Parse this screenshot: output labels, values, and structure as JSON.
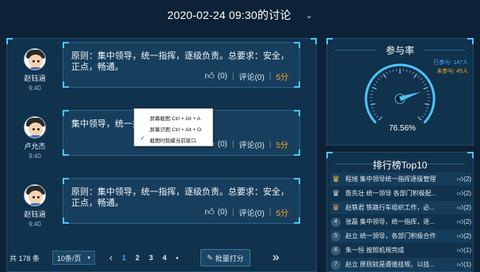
{
  "header": {
    "title": "2020-02-24 09:30的讨论",
    "chevron_icon": "chevron-down-icon"
  },
  "posts": [
    {
      "author": "赵钰涵",
      "time": "9:40",
      "content": "原则：集中领导，统一指挥，逐级负责。总要求：安全，正点，畅通。",
      "likes": "(0)",
      "comments": "评论(0)",
      "score": "5分"
    },
    {
      "author": "卢允杰",
      "time": "9:40",
      "content": "集中领导，统一指挥",
      "likes": "(0)",
      "comments": "评论(0)",
      "score": "5分"
    },
    {
      "author": "赵钰涵",
      "time": "9:40",
      "content": "原则：集中领导，统一指挥，逐级负责。总要求：安全，正点，畅通。",
      "likes": "(0)",
      "comments": "评论(0)",
      "score": "5分"
    }
  ],
  "pagination": {
    "total": "共 178 条",
    "page_size": "10条/页",
    "pages": [
      "1",
      "2",
      "3",
      "4"
    ],
    "ellipsis": "•",
    "active_page": "1",
    "batch_button": "批量打分"
  },
  "context_menu": {
    "items": [
      "屏幕截图 Ctrl + Alt + A",
      "屏幕识图 Ctrl + Alt + O",
      "截图时隐藏当前窗口"
    ],
    "checked_item": "截图时隐藏当前窗口"
  },
  "participation": {
    "title": "参与率",
    "joined_label": "已参与: 147人",
    "not_joined_label": "未参与: 45人",
    "percent_text": "76.56%",
    "value": 76.56,
    "colors": {
      "joined": "#4fa8ff",
      "not_joined": "#f5a623",
      "accent": "#4fc3f7"
    }
  },
  "ranking": {
    "title": "排行榜Top10",
    "rows": [
      {
        "rank": "1",
        "text": "程旭 集中领导统一指挥逐级管理",
        "likes": "(2)"
      },
      {
        "rank": "2",
        "text": "詹先壮 统一领导 各部门积极配...",
        "likes": "(2)"
      },
      {
        "rank": "3",
        "text": "赵轶君 铁路行车组织工作，必...",
        "likes": "(2)"
      },
      {
        "rank": "4",
        "text": "张磊 集中领导，统一指挥，逐...",
        "likes": "(2)"
      },
      {
        "rank": "5",
        "text": "赵立 统一领导，各部门积极合作",
        "likes": "(2)"
      },
      {
        "rank": "6",
        "text": "朱一恒 按照机规完成",
        "likes": "(1)"
      },
      {
        "rank": "7",
        "text": "赵立 原则就是遵循技规，以技...",
        "likes": "(1)"
      }
    ]
  }
}
